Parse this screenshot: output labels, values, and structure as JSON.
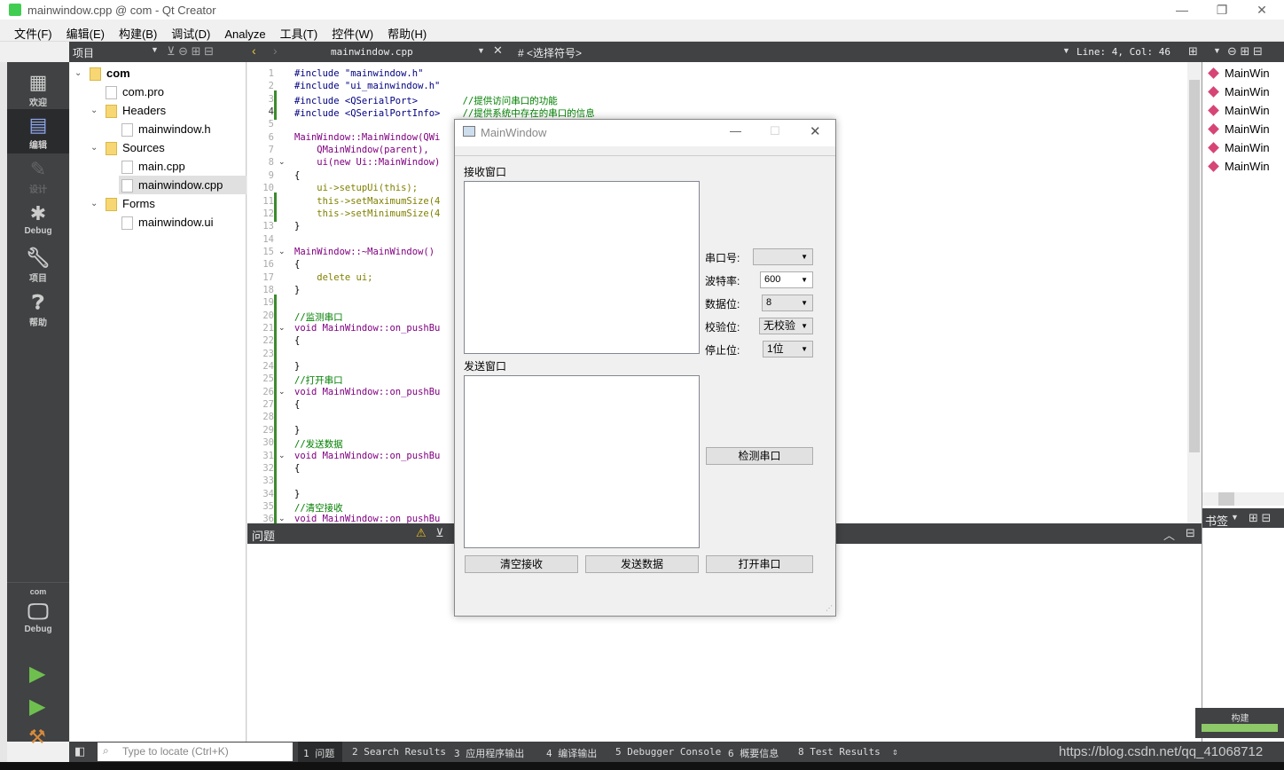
{
  "window": {
    "title": "mainwindow.cpp @ com - Qt Creator",
    "minimize": "—",
    "maximize": "❐",
    "close": "✕",
    "qt_logo": "Qt"
  },
  "menu": [
    "文件(F)",
    "编辑(E)",
    "构建(B)",
    "调试(D)",
    "Analyze",
    "工具(T)",
    "控件(W)",
    "帮助(H)"
  ],
  "toolbar": {
    "project_selector": "项目",
    "file_tab": "mainwindow.cpp",
    "symbol": "# <选择符号>",
    "cursor": "Line: 4, Col: 46"
  },
  "modes": [
    {
      "label": "欢迎",
      "icon": "grid-icon"
    },
    {
      "label": "编辑",
      "icon": "edit-icon"
    },
    {
      "label": "设计",
      "icon": "pencil-icon"
    },
    {
      "label": "Debug",
      "icon": "bug-icon"
    },
    {
      "label": "项目",
      "icon": "wrench-icon"
    },
    {
      "label": "帮助",
      "icon": "help-icon"
    }
  ],
  "kit": {
    "project": "com",
    "config": "Debug"
  },
  "tree": [
    {
      "label": "com",
      "level": 0,
      "expanded": true,
      "bold": true
    },
    {
      "label": "com.pro",
      "level": 1
    },
    {
      "label": "Headers",
      "level": 1,
      "expanded": true
    },
    {
      "label": "mainwindow.h",
      "level": 2
    },
    {
      "label": "Sources",
      "level": 1,
      "expanded": true
    },
    {
      "label": "main.cpp",
      "level": 2
    },
    {
      "label": "mainwindow.cpp",
      "level": 2,
      "selected": true
    },
    {
      "label": "Forms",
      "level": 1,
      "expanded": true
    },
    {
      "label": "mainwindow.ui",
      "level": 2
    }
  ],
  "code": [
    "#include \"mainwindow.h\"",
    "#include \"ui_mainwindow.h\"",
    "#include <QSerialPort>        //提供访问串口的功能",
    "#include <QSerialPortInfo>    //提供系统中存在的串口的信息",
    "",
    "MainWindow::MainWindow(QWi",
    "    QMainWindow(parent),",
    "    ui(new Ui::MainWindow)",
    "{",
    "    ui->setupUi(this);",
    "    this->setMaximumSize(4",
    "    this->setMinimumSize(4",
    "}",
    "",
    "MainWindow::~MainWindow()",
    "{",
    "    delete ui;",
    "}",
    "",
    "//监测串口",
    "void MainWindow::on_pushBu",
    "{",
    "",
    "}",
    "//打开串口",
    "void MainWindow::on_pushBu",
    "{",
    "",
    "}",
    "//发送数据",
    "void MainWindow::on_pushBu",
    "{",
    "",
    "}",
    "//清空接收",
    "void MainWindow::on_pushBu"
  ],
  "issues": {
    "title": "问题"
  },
  "outline": [
    "MainWin",
    "MainWin",
    "MainWin",
    "MainWin",
    "MainWin",
    "MainWin"
  ],
  "bookmarks": {
    "title": "书签"
  },
  "build": {
    "label": "构建",
    "progress": 1.0
  },
  "status": {
    "locate_placeholder": "Type to locate (Ctrl+K)",
    "tabs": [
      "1 问题",
      "2 Search Results",
      "3 应用程序输出",
      "4 编译输出",
      "5 Debugger Console",
      "6 概要信息",
      "8 Test Results"
    ],
    "watermark": "https://blog.csdn.net/qq_41068712"
  },
  "dialog": {
    "title": "MainWindow",
    "receive_label": "接收窗口",
    "send_label": "发送窗口",
    "fields": [
      {
        "label": "串口号:",
        "value": ""
      },
      {
        "label": "波特率:",
        "value": "600"
      },
      {
        "label": "数据位:",
        "value": "8"
      },
      {
        "label": "校验位:",
        "value": "无校验"
      },
      {
        "label": "停止位:",
        "value": "1位"
      }
    ],
    "detect_button": "检测串口",
    "clear_button": "清空接收",
    "send_button": "发送数据",
    "open_button": "打开串口"
  }
}
